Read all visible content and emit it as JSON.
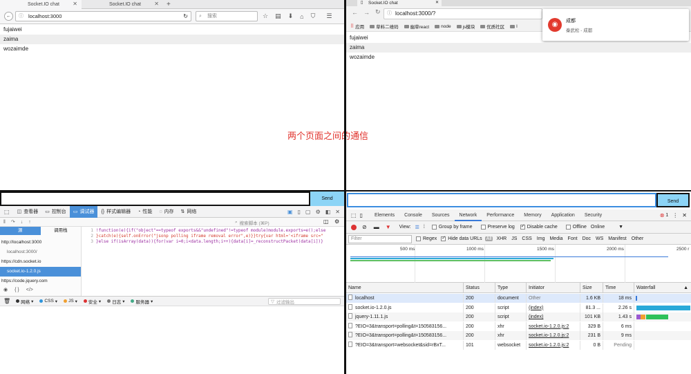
{
  "left_browser": {
    "tabs": [
      {
        "label": "Socket.IO chat"
      },
      {
        "label": "Socket.IO chat"
      }
    ],
    "url": "localhost:3000",
    "search_placeholder": "搜索",
    "messages": [
      "fujaiwei",
      "zaima",
      "wozaimde"
    ],
    "send_label": "Send",
    "devtools": {
      "tabs": [
        "查看器",
        "控制台",
        "调试器",
        "样式编辑器",
        "性能",
        "内存",
        "网络"
      ],
      "active_tab": "调试器",
      "search_placeholder": "搜索脚本 (⌘P)",
      "sources_tab": "源",
      "callstack_tab": "调用栈",
      "sources": [
        "http://localhost:3000",
        "localhost:3000/",
        "https://cdn.socket.io",
        "socket.io-1.2.0.js",
        "https://code.jquery.com"
      ],
      "code_lines": [
        {
          "n": "1",
          "text": "!function(e){if(\"object\"==typeof exports&&\"undefined\"!=typeof module)module.exports=e();else"
        },
        {
          "n": "2",
          "text": "}catch(e){self.onError(\"jsonp polling iframe removal error\",e)}}try{var html='<iframe src=\""
        },
        {
          "n": "3",
          "text": "}else if(isArray(data)){for(var i=0;i<data.length;i++){data[i]=_reconstructPacket(data[i])}"
        }
      ],
      "footer": [
        {
          "label": "网络",
          "color": "#333"
        },
        {
          "label": "CSS",
          "color": "#2f96dd"
        },
        {
          "label": "JS",
          "color": "#f0a030"
        },
        {
          "label": "安全",
          "color": "#d33"
        },
        {
          "label": "日志",
          "color": "#777"
        },
        {
          "label": "服务器",
          "color": "#4a8"
        }
      ],
      "filter_placeholder": "过滤输出"
    }
  },
  "center_label": "两个页面之间的通信",
  "right_browser": {
    "tab": "Socket.IO chat",
    "url": "localhost:3000/?",
    "bookmarks": [
      "应用",
      "草料二维码",
      "幽草react",
      "node",
      "js模块",
      "优质社区",
      "l"
    ],
    "notification": {
      "title": "成都",
      "subtitle": "秦武松 - 成都"
    },
    "messages": [
      "fujaiwei",
      "zaima",
      "wozaimde"
    ],
    "send_label": "Send",
    "devtools": {
      "tabs": [
        "Elements",
        "Console",
        "Sources",
        "Network",
        "Performance",
        "Memory",
        "Application",
        "Security"
      ],
      "active_tab": "Network",
      "error_count": "1",
      "toolbar": {
        "view": "View:",
        "group_by_frame": "Group by frame",
        "preserve_log": "Preserve log",
        "disable_cache": "Disable cache",
        "offline": "Offline",
        "throttle": "Online"
      },
      "filter_placeholder": "Filter",
      "regex": "Regex",
      "hide_data_urls": "Hide data URLs",
      "types": [
        "All",
        "XHR",
        "JS",
        "CSS",
        "Img",
        "Media",
        "Font",
        "Doc",
        "WS",
        "Manifest",
        "Other"
      ],
      "ticks": [
        "500 ms",
        "1000 ms",
        "1500 ms",
        "2000 ms",
        "2500 r"
      ],
      "columns": [
        "Name",
        "Status",
        "Type",
        "Initiator",
        "Size",
        "Time",
        "Waterfall"
      ],
      "rows": [
        {
          "name": "localhost",
          "status": "200",
          "type": "document",
          "initiator": "Other",
          "size": "1.6 KB",
          "time": "18 ms"
        },
        {
          "name": "socket.io-1.2.0.js",
          "status": "200",
          "type": "script",
          "initiator": "(index)",
          "size": "81.3 ...",
          "time": "2.26 s"
        },
        {
          "name": "jquery-1.11.1.js",
          "status": "200",
          "type": "script",
          "initiator": "(index)",
          "size": "101 KB",
          "time": "1.43 s"
        },
        {
          "name": "?EIO=3&transport=polling&t=150583156...",
          "status": "200",
          "type": "xhr",
          "initiator": "socket.io-1.2.0.js:2",
          "size": "329 B",
          "time": "6 ms"
        },
        {
          "name": "?EIO=3&transport=polling&t=150583156...",
          "status": "200",
          "type": "xhr",
          "initiator": "socket.io-1.2.0.js:2",
          "size": "231 B",
          "time": "9 ms"
        },
        {
          "name": "?EIO=3&transport=websocket&sid=rBxT...",
          "status": "101",
          "type": "websocket",
          "initiator": "socket.io-1.2.0.js:2",
          "size": "0 B",
          "time": "Pending"
        }
      ]
    }
  }
}
